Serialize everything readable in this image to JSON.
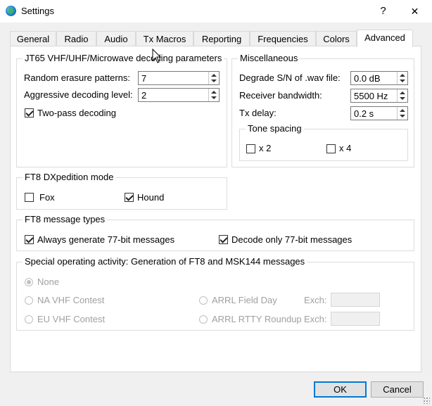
{
  "window": {
    "title": "Settings",
    "help_glyph": "?",
    "close_glyph": "✕"
  },
  "tabs": [
    {
      "label": "General"
    },
    {
      "label": "Radio"
    },
    {
      "label": "Audio"
    },
    {
      "label": "Tx Macros"
    },
    {
      "label": "Reporting"
    },
    {
      "label": "Frequencies"
    },
    {
      "label": "Colors"
    },
    {
      "label": "Advanced"
    }
  ],
  "active_tab": "Advanced",
  "jt65": {
    "title": "JT65 VHF/UHF/Microwave decoding parameters",
    "random_erasure_label": "Random erasure patterns:",
    "random_erasure_value": "7",
    "aggressive_label": "Aggressive decoding level:",
    "aggressive_value": "2",
    "two_pass_label": "Two-pass decoding",
    "two_pass_checked": true
  },
  "misc": {
    "title": "Miscellaneous",
    "degrade_label": "Degrade S/N of .wav file:",
    "degrade_value": "0.0 dB",
    "bandwidth_label": "Receiver bandwidth:",
    "bandwidth_value": "5500  Hz",
    "txdelay_label": "Tx delay:",
    "txdelay_value": "0.2  s",
    "tone_spacing_title": "Tone spacing",
    "x2_label": "x 2",
    "x4_label": "x 4"
  },
  "dxped": {
    "title": "FT8 DXpedition mode",
    "fox_label": "Fox",
    "hound_label": "Hound",
    "hound_checked": true
  },
  "msgtypes": {
    "title": "FT8 message types",
    "always77_label": "Always generate 77-bit messages",
    "decode77_label": "Decode only 77-bit messages"
  },
  "special": {
    "title": "Special operating activity:  Generation of FT8 and MSK144 messages",
    "none_label": "None",
    "na_vhf_label": "NA VHF Contest",
    "eu_vhf_label": "EU VHF Contest",
    "arrl_field_label": "ARRL Field Day",
    "arrl_rtty_label": "ARRL RTTY Roundup",
    "exch_label": "Exch:"
  },
  "buttons": {
    "ok": "OK",
    "cancel": "Cancel"
  },
  "colors": {
    "accent": "#0078d7",
    "dialog_bg": "#f0f0f0",
    "panel_bg": "#ffffff"
  }
}
